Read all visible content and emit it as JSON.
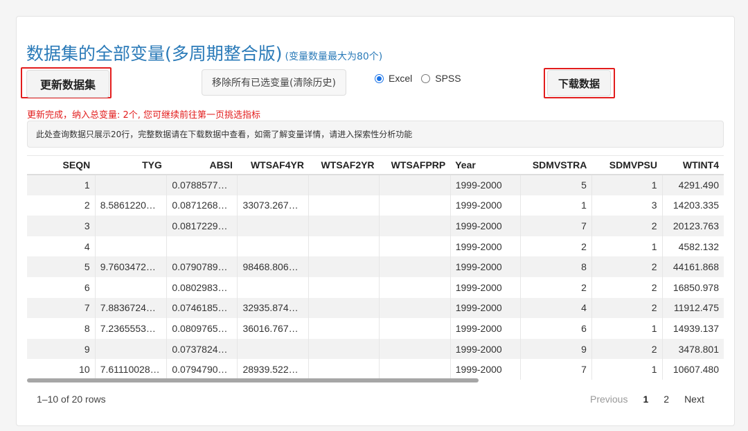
{
  "header": {
    "title": "数据集的全部变量(多周期整合版)",
    "subtitle": "(变量数量最大为80个)"
  },
  "toolbar": {
    "update_label": "更新数据集",
    "clear_label": "移除所有已选变量(清除历史)",
    "format_options": [
      {
        "label": "Excel",
        "selected": true
      },
      {
        "label": "SPSS",
        "selected": false
      }
    ],
    "download_label": "下载数据"
  },
  "status_message": "更新完成，纳入总变量: 2个, 您可继续前往第一页挑选指标",
  "notice": "此处查询数据只展示20行，完整数据请在下载数据中查看，如需了解变量详情，请进入探索性分析功能",
  "table": {
    "columns": [
      "SEQN",
      "TYG",
      "ABSI",
      "WTSAF4YR",
      "WTSAF2YR",
      "WTSAFPRP",
      "Year",
      "SDMVSTRA",
      "SDMVPSU",
      "WTINT4"
    ],
    "rows": [
      [
        "1",
        "",
        "0.0788577…",
        "",
        "",
        "",
        "1999-2000",
        "5",
        "1",
        "4291.490"
      ],
      [
        "2",
        "8.5861220…",
        "0.0871268…",
        "33073.267…",
        "",
        "",
        "1999-2000",
        "1",
        "3",
        "14203.335"
      ],
      [
        "3",
        "",
        "0.0817229…",
        "",
        "",
        "",
        "1999-2000",
        "7",
        "2",
        "20123.763"
      ],
      [
        "4",
        "",
        "",
        "",
        "",
        "",
        "1999-2000",
        "2",
        "1",
        "4582.132"
      ],
      [
        "5",
        "9.7603472…",
        "0.0790789…",
        "98468.806…",
        "",
        "",
        "1999-2000",
        "8",
        "2",
        "44161.868"
      ],
      [
        "6",
        "",
        "0.0802983…",
        "",
        "",
        "",
        "1999-2000",
        "2",
        "2",
        "16850.978"
      ],
      [
        "7",
        "7.8836724…",
        "0.0746185…",
        "32935.874…",
        "",
        "",
        "1999-2000",
        "4",
        "2",
        "11912.475"
      ],
      [
        "8",
        "7.2365553…",
        "0.0809765…",
        "36016.767…",
        "",
        "",
        "1999-2000",
        "6",
        "1",
        "14939.137"
      ],
      [
        "9",
        "",
        "0.0737824…",
        "",
        "",
        "",
        "1999-2000",
        "9",
        "2",
        "3478.801"
      ],
      [
        "10",
        "7.61110028…",
        "0.0794790…",
        "28939.522…",
        "",
        "",
        "1999-2000",
        "7",
        "1",
        "10607.480"
      ]
    ]
  },
  "footer": {
    "range_text": "1–10 of 20 rows",
    "previous": "Previous",
    "pages": [
      "1",
      "2"
    ],
    "current_page": "1",
    "next": "Next"
  },
  "colors": {
    "title": "#2a7ab8",
    "highlight": "#e21c1c",
    "radio_selected": "#1a73e8"
  }
}
